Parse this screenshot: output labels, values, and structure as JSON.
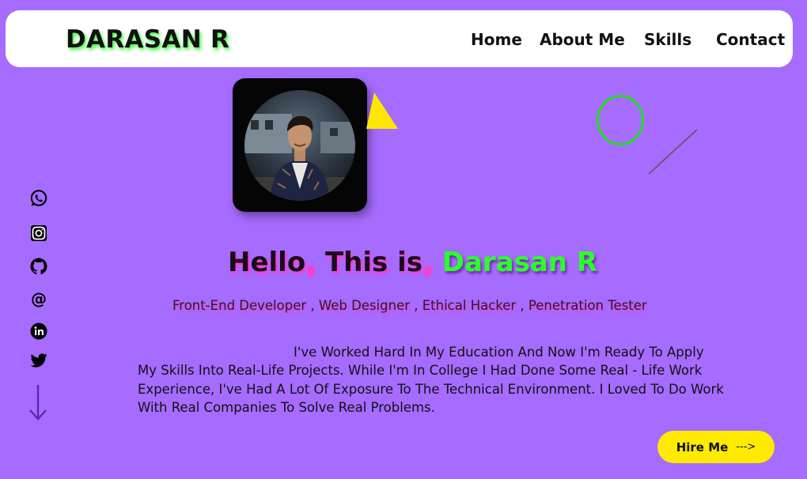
{
  "header": {
    "logo": "DARASAN R",
    "nav": {
      "home": "Home",
      "about": "About  Me",
      "skills": "Skills",
      "contact": "Contact"
    }
  },
  "social": [
    {
      "name": "whatsapp-icon"
    },
    {
      "name": "instagram-icon"
    },
    {
      "name": "github-icon"
    },
    {
      "name": "email-icon"
    },
    {
      "name": "linkedin-icon"
    },
    {
      "name": "twitter-icon"
    }
  ],
  "hero": {
    "greeting": "Hello",
    "comma1": ",",
    "this_is": " This is",
    "comma2": ",",
    "name": " Darasan R",
    "roles": "Front-End Developer , Web Designer , Ethical Hacker , Penetration Tester"
  },
  "about": {
    "line1": "I've Worked Hard In My Education And Now I'm Ready To Apply",
    "line2": "My Skills Into Real-Life Projects. While I'm In College I Had Done Some  Real - Life  Work",
    "line3": "Experience, I've Had A Lot Of Exposure To The Technical  Environment. I Loved To Do  Work",
    "line4": "With Real Companies To Solve Real Problems."
  },
  "cta": {
    "hire_label": "Hire Me",
    "hire_arrow": "--->"
  },
  "colors": {
    "background": "#a66bff",
    "accent_green": "#2bff2b",
    "accent_pink": "#ff3cc8",
    "button_yellow": "#ffea00"
  }
}
